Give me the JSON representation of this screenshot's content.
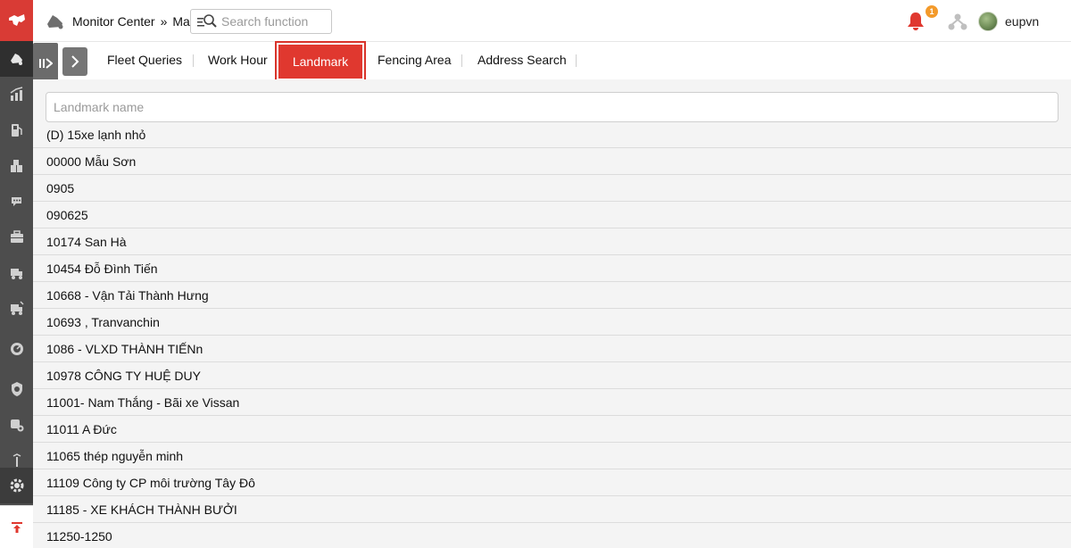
{
  "header": {
    "breadcrumb_root": "Monitor Center",
    "breadcrumb_sep": "»",
    "breadcrumb_current": "Map",
    "search_placeholder": "Search function",
    "notification_count": "1",
    "username": "eupvn"
  },
  "tabs": [
    {
      "label": "Fleet Queries"
    },
    {
      "label": "Work Hour"
    },
    {
      "label": "Landmark"
    },
    {
      "label": "Fencing Area"
    },
    {
      "label": "Address Search"
    }
  ],
  "active_tab": "Landmark",
  "landmark": {
    "name_placeholder": "Landmark name",
    "items": [
      "(D) 15xe lạnh nhỏ",
      "00000 Mẫu Sơn",
      "0905",
      "090625",
      "10174 San Hà",
      "10454 Đỗ Đình Tiến",
      "10668 - Vận Tải Thành Hưng",
      "10693 , Tranvanchin",
      "1086 - VLXD THÀNH TIẾNn",
      "10978 CÔNG TY HUỆ DUY",
      "11001- Nam Thắng - Bãi xe Vissan",
      "11011 A Đức",
      "11065 thép nguyễn minh",
      "11109 Công ty CP môi trường Tây Đô",
      "11185 - XE KHÁCH THÀNH BƯỞI",
      "11250-1250"
    ]
  },
  "colors": {
    "brand_red": "#d93b35",
    "rail_gray": "#4d4d4d",
    "badge_orange": "#f39a2b"
  }
}
